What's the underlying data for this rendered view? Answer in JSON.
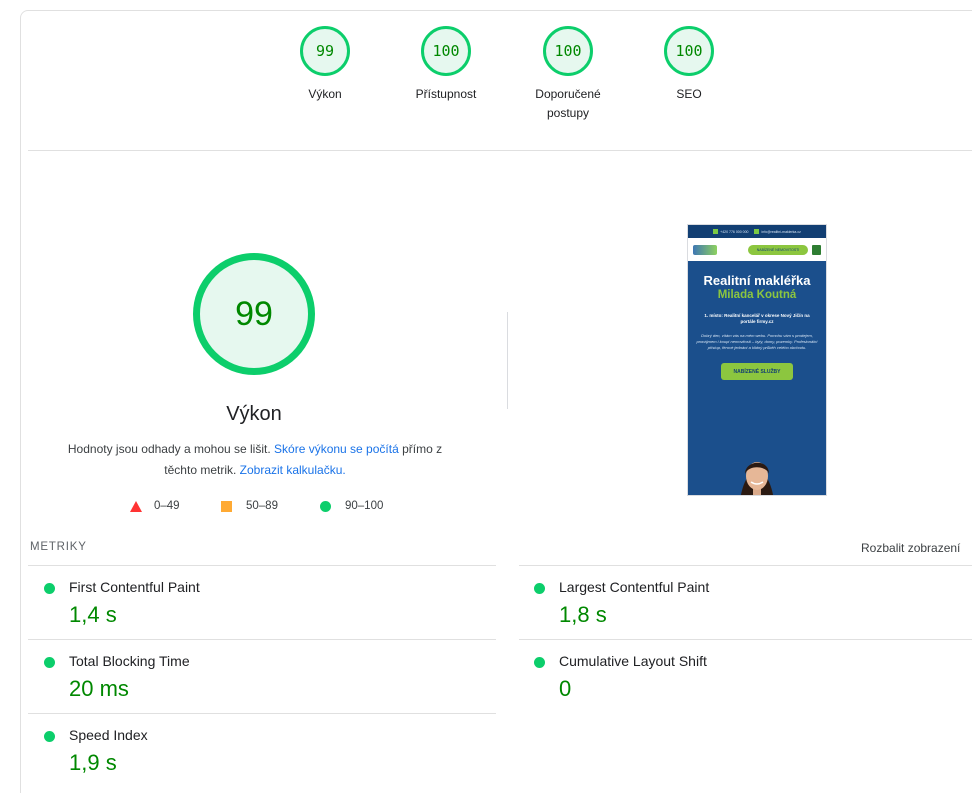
{
  "summary_gauges": [
    {
      "score": "99",
      "label": "Výkon"
    },
    {
      "score": "100",
      "label": "Přístupnost"
    },
    {
      "score": "100",
      "label": "Doporučené postupy"
    },
    {
      "score": "100",
      "label": "SEO"
    }
  ],
  "performance": {
    "score": "99",
    "title": "Výkon",
    "desc_prefix": "Hodnoty jsou odhady a mohou se lišit. ",
    "desc_link1": "Skóre výkonu se počítá",
    "desc_mid": " přímo z těchto metrik. ",
    "desc_link2": "Zobrazit kalkulačku.",
    "legend": [
      {
        "range": "0–49",
        "color": "#ff3333",
        "shape": "triangle"
      },
      {
        "range": "50–89",
        "color": "#ffaa33",
        "shape": "square"
      },
      {
        "range": "90–100",
        "color": "#0cce6b",
        "shape": "circle"
      }
    ]
  },
  "screenshot": {
    "topbar_items": [
      "+420 776 000 000",
      "info@realitni-maklerka.cz"
    ],
    "nav_button": "NABÍZENÉ NEMOVITOSTI",
    "headline1": "Realitní makléřka",
    "headline2": "Milada Koutná",
    "subheading": "1. místo: Realitní kancelář v okrese Nový Jičín na portále firmy.cz",
    "paragraph": "Dobrý den, vítám vás na mém webu. Pomohu vám s prodejem, pronájmem i koupí nemovitosti – byty, domy, pozemky. Profesionální přístup, férové jednání a klidný průběh celého obchodu.",
    "cta": "NABÍZENÉ SLUŽBY"
  },
  "metrics": {
    "heading": "METRIKY",
    "expand_label": "Rozbalit zobrazení",
    "items": [
      {
        "name": "First Contentful Paint",
        "value": "1,4 s",
        "status_color": "#0cce6b"
      },
      {
        "name": "Largest Contentful Paint",
        "value": "1,8 s",
        "status_color": "#0cce6b"
      },
      {
        "name": "Total Blocking Time",
        "value": "20 ms",
        "status_color": "#0cce6b"
      },
      {
        "name": "Cumulative Layout Shift",
        "value": "0",
        "status_color": "#0cce6b"
      },
      {
        "name": "Speed Index",
        "value": "1,9 s",
        "status_color": "#0cce6b"
      }
    ]
  },
  "colors": {
    "pass_green": "#0cce6b",
    "pass_text": "#008800",
    "link_blue": "#1a73e8"
  }
}
